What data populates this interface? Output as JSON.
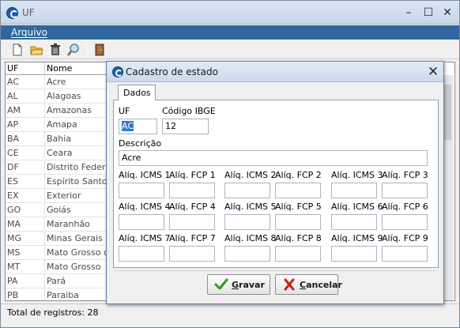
{
  "window": {
    "title": "UF",
    "minimize_glyph": "–",
    "maximize_glyph": "☐",
    "close_glyph": "✕"
  },
  "menu": {
    "items": [
      {
        "label": "Arquivo"
      }
    ]
  },
  "toolbar": {
    "icons": [
      "new-document-icon",
      "open-folder-icon",
      "trash-icon",
      "search-icon",
      "exit-door-icon"
    ]
  },
  "grid": {
    "columns": [
      "UF",
      "Nome"
    ],
    "rows": [
      [
        "AC",
        "Acre"
      ],
      [
        "AL",
        "Alagoas"
      ],
      [
        "AM",
        "Amazonas"
      ],
      [
        "AP",
        "Amapa"
      ],
      [
        "BA",
        "Bahia"
      ],
      [
        "CE",
        "Ceara"
      ],
      [
        "DF",
        "Distrito Federal"
      ],
      [
        "ES",
        "Espírito Santo"
      ],
      [
        "EX",
        "Exterior"
      ],
      [
        "GO",
        "Goiás"
      ],
      [
        "MA",
        "Maranhão"
      ],
      [
        "MG",
        "Minas Gerais"
      ],
      [
        "MS",
        "Mato Grosso do Sul"
      ],
      [
        "MT",
        "Mato Grosso"
      ],
      [
        "PA",
        "Pará"
      ],
      [
        "PB",
        "Paraiba"
      ]
    ]
  },
  "status": {
    "text": "Total de registros: 28"
  },
  "dialog": {
    "title": "Cadastro de estado",
    "close_glyph": "✕",
    "tab": "Dados",
    "uf": {
      "label": "UF",
      "value": "AC"
    },
    "ibge": {
      "label": "Código IBGE",
      "value": "12"
    },
    "descricao": {
      "label": "Descrição",
      "value": "Acre"
    },
    "tax_fields": [
      {
        "label": "Alíq. ICMS 1",
        "value": ""
      },
      {
        "label": "Alíq. FCP 1",
        "value": ""
      },
      {
        "label": "Alíq. ICMS 2",
        "value": ""
      },
      {
        "label": "Alíq. FCP 2",
        "value": ""
      },
      {
        "label": "Alíq. ICMS 3",
        "value": ""
      },
      {
        "label": "Alíq. FCP 3",
        "value": ""
      },
      {
        "label": "Alíq. ICMS 4",
        "value": ""
      },
      {
        "label": "Alíq. FCP 4",
        "value": ""
      },
      {
        "label": "Alíq. ICMS 5",
        "value": ""
      },
      {
        "label": "Alíq. FCP 5",
        "value": ""
      },
      {
        "label": "Alíq. ICMS 6",
        "value": ""
      },
      {
        "label": "Alíq. FCP 6",
        "value": ""
      },
      {
        "label": "Alíq. ICMS 7",
        "value": ""
      },
      {
        "label": "Alíq. FCP 7",
        "value": ""
      },
      {
        "label": "Alíq. ICMS 8",
        "value": ""
      },
      {
        "label": "Alíq. FCP 8",
        "value": ""
      },
      {
        "label": "Alíq. ICMS 9",
        "value": ""
      },
      {
        "label": "Alíq. FCP 9",
        "value": ""
      }
    ],
    "buttons": {
      "save": "Gravar",
      "cancel": "Cancelar"
    }
  },
  "colors": {
    "menubar": "#30669e",
    "selection": "#3378d6",
    "save_check": "#2e9a1e",
    "cancel_x": "#c8201a"
  }
}
